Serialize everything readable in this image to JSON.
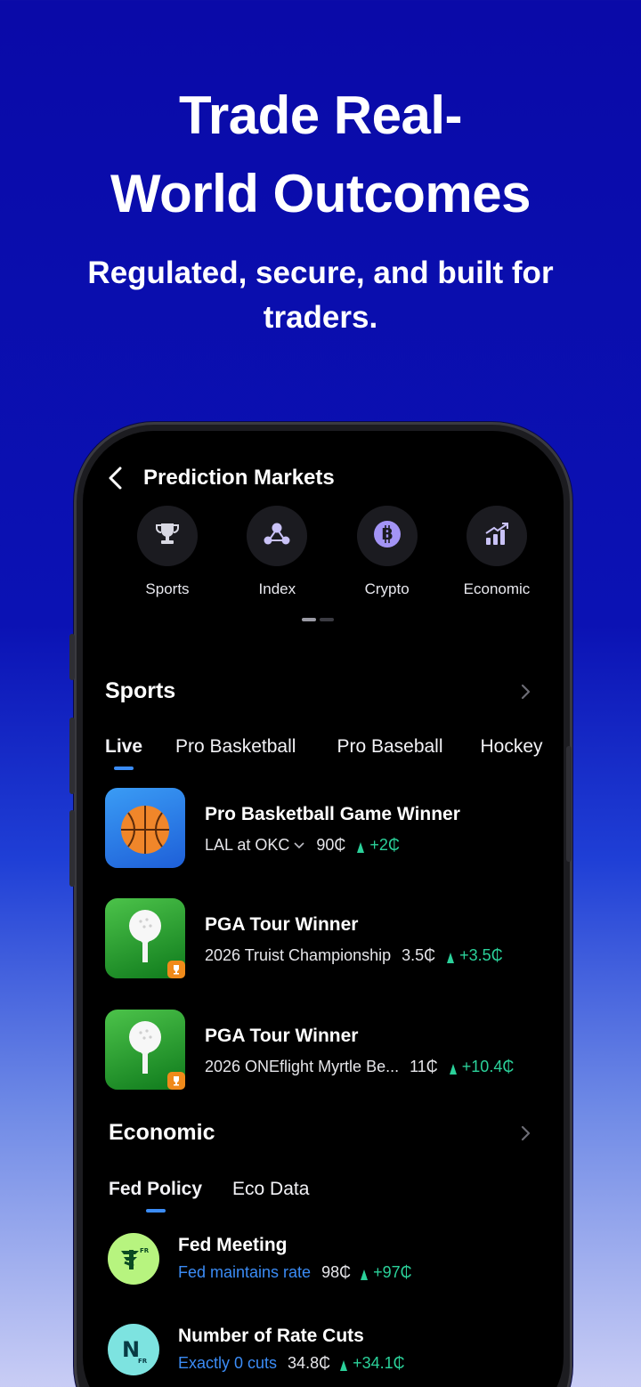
{
  "hero": {
    "title_line1": "Trade Real-",
    "title_line2": "World Outcomes",
    "subtitle_line1": "Regulated, secure, and built for",
    "subtitle_line2": "traders."
  },
  "colors": {
    "background": "#0a0aa8",
    "accent": "#3b8cf6",
    "positive": "#2bd19a",
    "screen": "#000000"
  },
  "app": {
    "title": "Prediction Markets",
    "categories": [
      {
        "label": "Sports",
        "icon": "trophy-icon"
      },
      {
        "label": "Index",
        "icon": "network-icon"
      },
      {
        "label": "Crypto",
        "icon": "bitcoin-icon"
      },
      {
        "label": "Economic",
        "icon": "chart-up-icon"
      }
    ],
    "sports": {
      "title": "Sports",
      "tabs": [
        "Live",
        "Pro Basketball",
        "Pro Baseball",
        "Hockey"
      ],
      "active_tab": "Live",
      "markets": [
        {
          "title": "Pro Basketball Game Winner",
          "subtitle": "LAL at OKC",
          "price": "90₵",
          "change": "+2₵",
          "thumb": "basketball-icon"
        },
        {
          "title": "PGA Tour Winner",
          "subtitle": "2026 Truist Championship",
          "price": "3.5₵",
          "change": "+3.5₵",
          "thumb": "golf-ball-icon"
        },
        {
          "title": "PGA Tour Winner",
          "subtitle": "2026 ONEflight Myrtle Be...",
          "price": "11₵",
          "change": "+10.4₵",
          "thumb": "golf-ball-icon"
        }
      ]
    },
    "economic": {
      "title": "Economic",
      "tabs": [
        "Fed Policy",
        "Eco Data"
      ],
      "active_tab": "Fed Policy",
      "markets": [
        {
          "title": "Fed Meeting",
          "subtitle": "Fed maintains rate",
          "price": "98₵",
          "change": "+97₵",
          "logo_letter": "",
          "logo_sub": "FR"
        },
        {
          "title": "Number of Rate Cuts",
          "subtitle": "Exactly 0 cuts",
          "price": "34.8₵",
          "change": "+34.1₵",
          "logo_letter": "N",
          "logo_sub": "FR"
        }
      ]
    }
  }
}
